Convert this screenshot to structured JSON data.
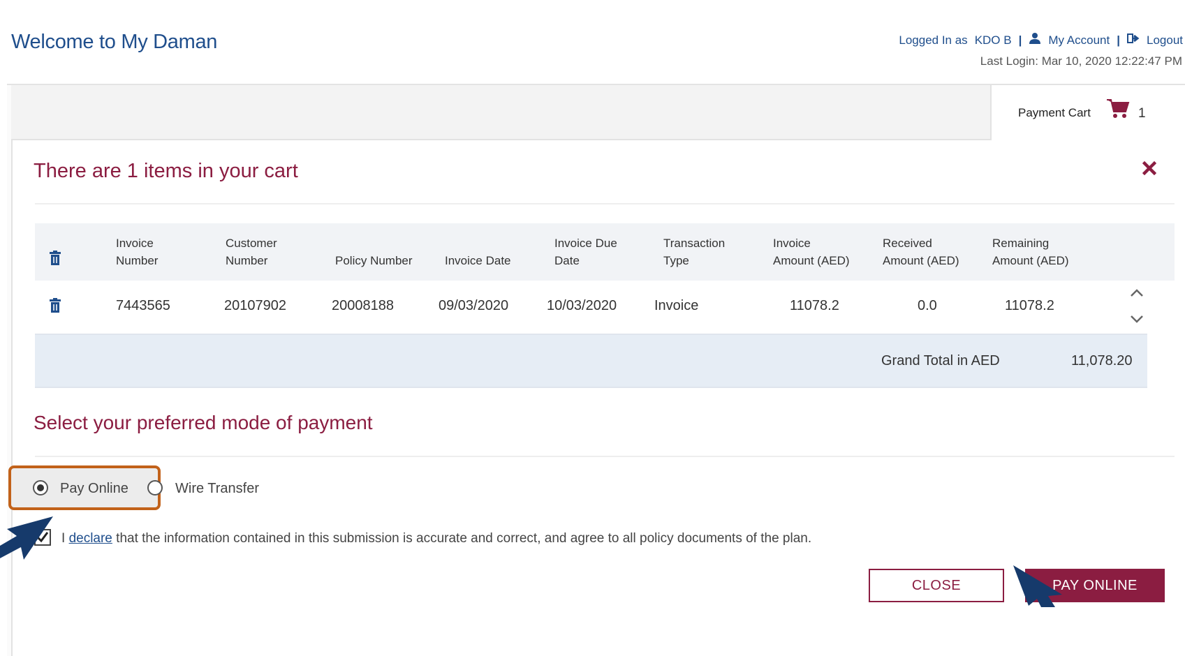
{
  "header": {
    "welcome": "Welcome to My Daman",
    "logged_in_label": "Logged In as",
    "user_name": "KDO B",
    "my_account": "My Account",
    "logout": "Logout",
    "last_login": "Last Login: Mar 10, 2020 12:22:47 PM"
  },
  "cart": {
    "label": "Payment Cart",
    "count": "1"
  },
  "modal": {
    "title": "There are 1 items in your cart",
    "columns": {
      "invoice_number": [
        "Invoice",
        "Number"
      ],
      "customer_number": [
        "Customer",
        "Number"
      ],
      "policy_number": "Policy Number",
      "invoice_date": "Invoice Date",
      "invoice_due_date": [
        "Invoice Due",
        "Date"
      ],
      "transaction_type": [
        "Transaction",
        "Type"
      ],
      "invoice_amount": [
        "Invoice",
        "Amount (AED)"
      ],
      "received_amount": [
        "Received",
        "Amount (AED)"
      ],
      "remaining_amount": [
        "Remaining",
        "Amount (AED)"
      ]
    },
    "rows": [
      {
        "invoice_number": "7443565",
        "customer_number": "20107902",
        "policy_number": "20008188",
        "invoice_date": "09/03/2020",
        "invoice_due_date": "10/03/2020",
        "transaction_type": "Invoice",
        "invoice_amount": "11078.2",
        "received_amount": "0.0",
        "remaining_amount": "11078.2"
      }
    ],
    "grand_total_label": "Grand Total in AED",
    "grand_total_value": "11,078.20",
    "payment_mode_title": "Select your preferred mode of payment",
    "options": [
      {
        "label": "Pay Online",
        "selected": true
      },
      {
        "label": "Wire Transfer",
        "selected": false
      }
    ],
    "declaration": {
      "prefix": "I",
      "link": "declare",
      "text": "that the information contained in this submission is accurate and correct, and agree to all policy documents of the plan."
    },
    "buttons": {
      "close": "CLOSE",
      "pay_online": "PAY ONLINE"
    }
  },
  "colors": {
    "brand_blue": "#1f4e8c",
    "brand_maroon": "#8b1d41",
    "highlight_orange": "#c2621a",
    "arrow_navy": "#163a6b"
  }
}
